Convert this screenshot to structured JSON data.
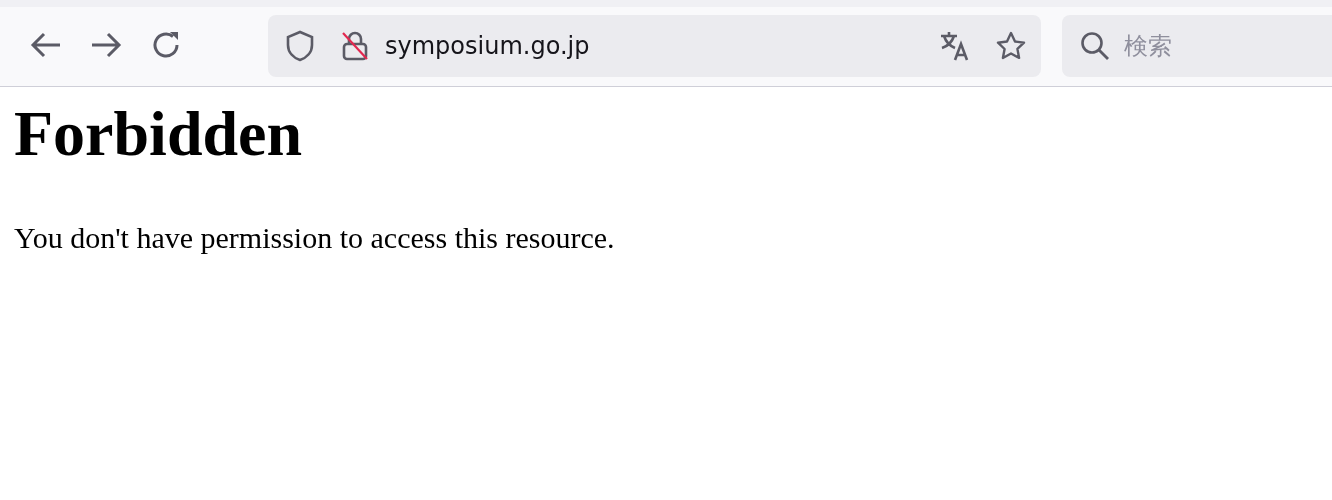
{
  "address_bar": {
    "url": "symposium.go.jp"
  },
  "search": {
    "placeholder": "検索"
  },
  "page": {
    "heading": "Forbidden",
    "message": "You don't have permission to access this resource."
  }
}
